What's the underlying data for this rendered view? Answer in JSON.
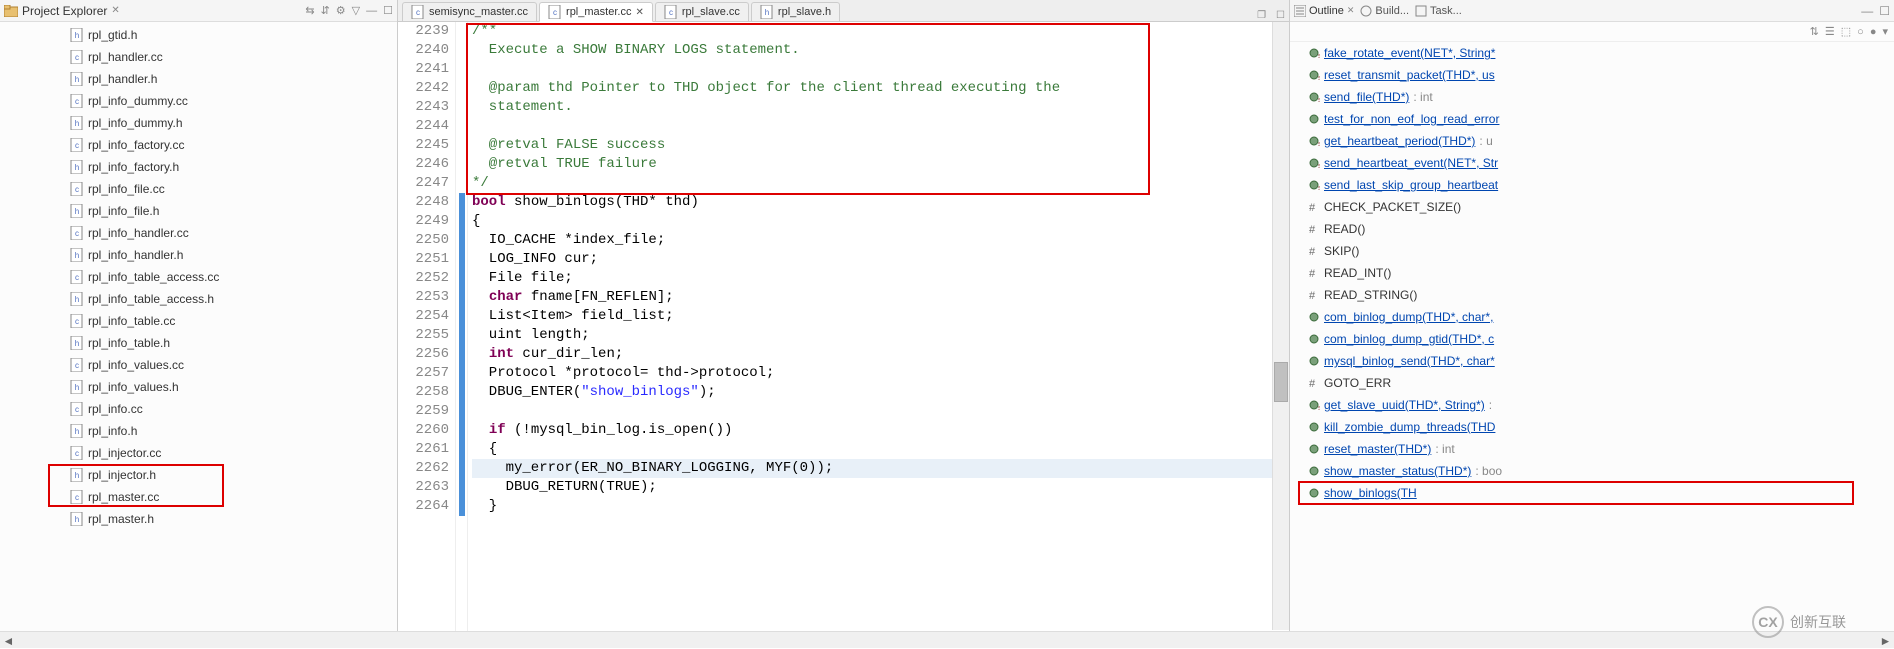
{
  "leftPanel": {
    "title": "Project Explorer",
    "files": [
      "rpl_gtid.h",
      "rpl_handler.cc",
      "rpl_handler.h",
      "rpl_info_dummy.cc",
      "rpl_info_dummy.h",
      "rpl_info_factory.cc",
      "rpl_info_factory.h",
      "rpl_info_file.cc",
      "rpl_info_file.h",
      "rpl_info_handler.cc",
      "rpl_info_handler.h",
      "rpl_info_table_access.cc",
      "rpl_info_table_access.h",
      "rpl_info_table.cc",
      "rpl_info_table.h",
      "rpl_info_values.cc",
      "rpl_info_values.h",
      "rpl_info.cc",
      "rpl_info.h",
      "rpl_injector.cc",
      "rpl_injector.h",
      "rpl_master.cc",
      "rpl_master.h"
    ]
  },
  "editor": {
    "tabs": [
      {
        "label": "semisync_master.cc",
        "active": false,
        "dirty": false
      },
      {
        "label": "rpl_master.cc",
        "active": true,
        "dirty": true
      },
      {
        "label": "rpl_slave.cc",
        "active": false,
        "dirty": false
      },
      {
        "label": "rpl_slave.h",
        "active": false,
        "dirty": false
      }
    ],
    "startLine": 2239,
    "lines": [
      {
        "t": "/**",
        "cls": "c-comment"
      },
      {
        "t": "  Execute a SHOW BINARY LOGS statement.",
        "cls": "c-comment"
      },
      {
        "t": "",
        "cls": ""
      },
      {
        "t": "  @param thd Pointer to THD object for the client thread executing the",
        "cls": "c-comment"
      },
      {
        "t": "  statement.",
        "cls": "c-comment"
      },
      {
        "t": "",
        "cls": ""
      },
      {
        "t": "  @retval FALSE success",
        "cls": "c-comment"
      },
      {
        "t": "  @retval TRUE failure",
        "cls": "c-comment"
      },
      {
        "t": "*/",
        "cls": "c-comment"
      },
      {
        "raw": "<span class=\"c-type\">bool</span> show_binlogs(THD* thd)"
      },
      {
        "t": "{",
        "cls": ""
      },
      {
        "t": "  IO_CACHE *index_file;",
        "cls": ""
      },
      {
        "t": "  LOG_INFO cur;",
        "cls": ""
      },
      {
        "t": "  File file;",
        "cls": ""
      },
      {
        "raw": "  <span class=\"c-type\">char</span> fname[FN_REFLEN];"
      },
      {
        "t": "  List<Item> field_list;",
        "cls": ""
      },
      {
        "t": "  uint length;",
        "cls": ""
      },
      {
        "raw": "  <span class=\"c-type\">int</span> cur_dir_len;"
      },
      {
        "t": "  Protocol *protocol= thd->protocol;",
        "cls": ""
      },
      {
        "raw": "  DBUG_ENTER(<span class=\"c-string\">\"show_binlogs\"</span>);"
      },
      {
        "t": "",
        "cls": ""
      },
      {
        "raw": "  <span class=\"c-keyword\">if</span> (!mysql_bin_log.is_open())"
      },
      {
        "t": "  {",
        "cls": ""
      },
      {
        "t": "    my_error(ER_NO_BINARY_LOGGING, MYF(0));",
        "cls": "",
        "hl": true
      },
      {
        "t": "    DBUG_RETURN(TRUE);",
        "cls": ""
      },
      {
        "t": "  }",
        "cls": ""
      }
    ]
  },
  "outline": {
    "tabs": {
      "outline": "Outline",
      "build": "Build...",
      "task": "Task..."
    },
    "items": [
      {
        "kind": "fn-s",
        "name": "fake_rotate_event(NET*, String*"
      },
      {
        "kind": "fn-s",
        "name": "reset_transmit_packet(THD*, us"
      },
      {
        "kind": "fn-s",
        "name": "send_file(THD*)",
        "ret": " : int"
      },
      {
        "kind": "fn",
        "name": "test_for_non_eof_log_read_error"
      },
      {
        "kind": "fn-s",
        "name": "get_heartbeat_period(THD*)",
        "ret": " : u"
      },
      {
        "kind": "fn-s",
        "name": "send_heartbeat_event(NET*, Str"
      },
      {
        "kind": "fn-s",
        "name": "send_last_skip_group_heartbeat"
      },
      {
        "kind": "macro",
        "name": "CHECK_PACKET_SIZE()"
      },
      {
        "kind": "macro",
        "name": "READ()"
      },
      {
        "kind": "macro",
        "name": "SKIP()"
      },
      {
        "kind": "macro",
        "name": "READ_INT()"
      },
      {
        "kind": "macro",
        "name": "READ_STRING()"
      },
      {
        "kind": "fn",
        "name": "com_binlog_dump(THD*, char*,"
      },
      {
        "kind": "fn",
        "name": "com_binlog_dump_gtid(THD*, c"
      },
      {
        "kind": "fn",
        "name": "mysql_binlog_send(THD*, char*"
      },
      {
        "kind": "macro",
        "name": "GOTO_ERR"
      },
      {
        "kind": "fn-s",
        "name": "get_slave_uuid(THD*, String*)",
        "ret": " :"
      },
      {
        "kind": "fn",
        "name": "kill_zombie_dump_threads(THD"
      },
      {
        "kind": "fn",
        "name": "reset_master(THD*)",
        "ret": " : int"
      },
      {
        "kind": "fn",
        "name": "show_master_status(THD*)",
        "ret": " : boo"
      },
      {
        "kind": "fn",
        "name": "show_binlogs(TH",
        "boxed": true
      }
    ]
  },
  "watermark": {
    "text": "创新互联",
    "logo": "CX"
  }
}
